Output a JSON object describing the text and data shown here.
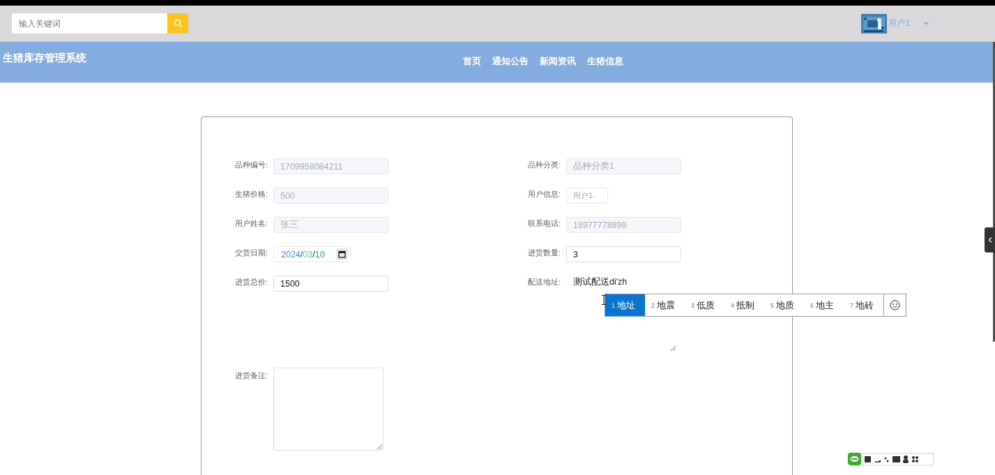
{
  "search": {
    "placeholder": "输入关键词"
  },
  "user": {
    "name": "用户1"
  },
  "site_title": "生猪库存管理系统",
  "nav": [
    {
      "label": "首页"
    },
    {
      "label": "通知公告"
    },
    {
      "label": "新闻资讯"
    },
    {
      "label": "生猪信息"
    }
  ],
  "form": {
    "fields": [
      {
        "label": "品种编号:",
        "kind": "text",
        "value": "1709958084211",
        "disabled": true
      },
      {
        "label": "品种分类:",
        "kind": "text",
        "value": "品种分类1",
        "disabled": true
      },
      {
        "label": "生猪价格:",
        "kind": "text",
        "value": "500",
        "disabled": true
      },
      {
        "label": "用户信息:",
        "kind": "select",
        "value": "用户1-"
      },
      {
        "label": "用户姓名:",
        "kind": "text",
        "value": "张三",
        "disabled": true
      },
      {
        "label": "联系电话:",
        "kind": "text",
        "value": "18977778899",
        "disabled": true
      },
      {
        "label": "交货日期:",
        "kind": "date",
        "parts": [
          "2024",
          "03",
          "10"
        ],
        "separator": "/"
      },
      {
        "label": "进货数量:",
        "kind": "text",
        "value": "3",
        "disabled": false
      },
      {
        "label": "进货总价:",
        "kind": "text",
        "value": "1500",
        "disabled": false
      },
      {
        "label": "配送地址:",
        "kind": "address",
        "value": "测试配送di'zh"
      },
      {
        "label": "进货备注:",
        "kind": "textarea"
      }
    ]
  },
  "ime": {
    "candidates": [
      {
        "index": "1",
        "text": "地址",
        "selected": true
      },
      {
        "index": "2",
        "text": "地震",
        "selected": false
      },
      {
        "index": "3",
        "text": "低质",
        "selected": false
      },
      {
        "index": "4",
        "text": "抵制",
        "selected": false
      },
      {
        "index": "5",
        "text": "地质",
        "selected": false
      },
      {
        "index": "6",
        "text": "地主",
        "selected": false
      },
      {
        "index": "7",
        "text": "地砖",
        "selected": false
      }
    ]
  }
}
